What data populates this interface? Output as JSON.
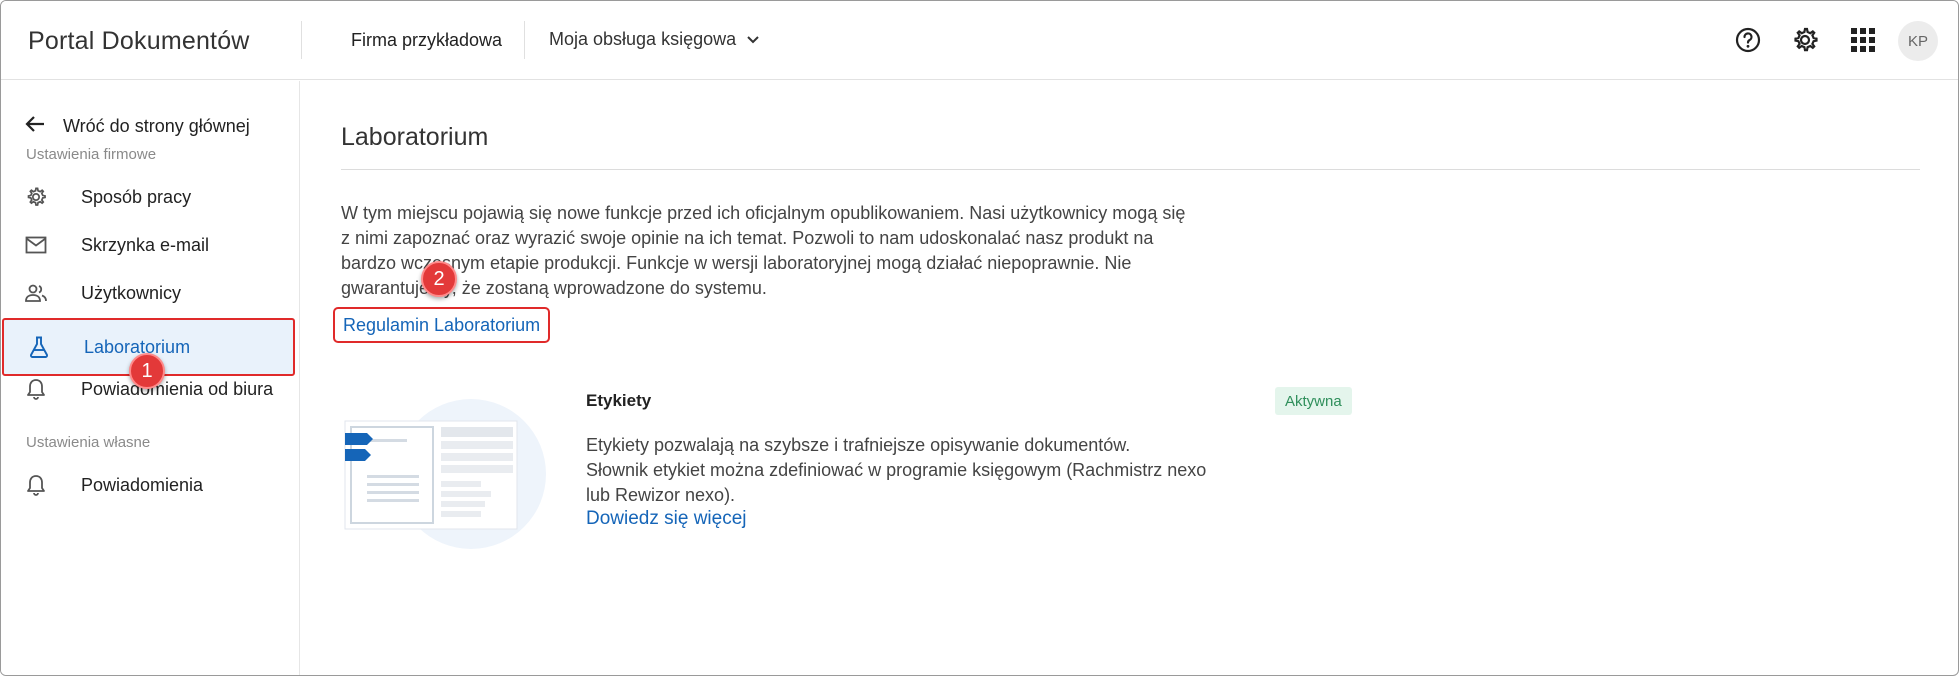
{
  "header": {
    "app_title": "Portal Dokumentów",
    "company": "Firma przykładowa",
    "service": "Moja obsługa księgowa",
    "avatar_initials": "KP",
    "icons": [
      "help-icon",
      "gear-icon",
      "apps-grid-icon",
      "chevron-down-icon"
    ]
  },
  "sidebar": {
    "back_label": "Wróć do strony głównej",
    "company_section": "Ustawienia firmowe",
    "personal_section": "Ustawienia własne",
    "items": [
      {
        "label": "Sposób pracy",
        "icon": "gear-icon"
      },
      {
        "label": "Skrzynka e-mail",
        "icon": "mail-icon"
      },
      {
        "label": "Użytkownicy",
        "icon": "users-icon"
      },
      {
        "label": "Laboratorium",
        "icon": "flask-icon",
        "active": true
      },
      {
        "label": "Powiadomienia od biura",
        "icon": "bell-icon"
      }
    ],
    "personal_items": [
      {
        "label": "Powiadomienia",
        "icon": "bell-icon"
      }
    ]
  },
  "markers": {
    "one": "1",
    "two": "2"
  },
  "main": {
    "title": "Laboratorium",
    "intro_lines": [
      "W tym miejscu pojawią się nowe funkcje przed ich oficjalnym opublikowaniem. Nasi użytkownicy mogą się",
      "z nimi zapoznać oraz wyrazić swoje opinie na ich temat. Pozwoli to nam udoskonalać nasz produkt na",
      "bardzo wczesnym etapie produkcji. Funkcje w wersji laboratoryjnej mogą działać niepoprawnie. Nie",
      "gwarantujemy, że zostaną wprowadzone do systemu."
    ],
    "rules_link": "Regulamin Laboratorium",
    "feature": {
      "name": "Etykiety",
      "status": "Aktywna",
      "desc_lines": [
        "Etykiety pozwalają na szybsze i trafniejsze opisywanie dokumentów.",
        "Słownik etykiet można zdefiniować w programie księgowym (Rachmistrz nexo",
        "lub Rewizor nexo)."
      ],
      "learn_more": "Dowiedz się więcej"
    }
  },
  "colors": {
    "accent": "#1565b8",
    "highlight": "#e02a2a",
    "active_bg": "#e9f2fb",
    "badge_bg": "#e4f5ec",
    "badge_text": "#2f8f5b"
  }
}
